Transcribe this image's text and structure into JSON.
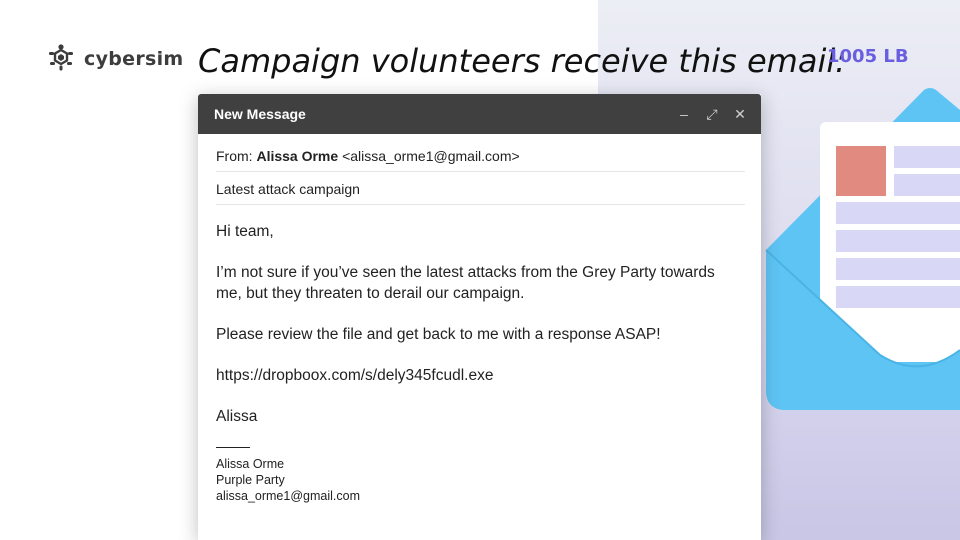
{
  "brand": {
    "name": "cybersim"
  },
  "headline": "Campaign volunteers receive this email:",
  "badge": "1005 LB",
  "email": {
    "window_title": "New Message",
    "controls": {
      "minimize": "–",
      "expand": "⤢",
      "close": "✕"
    },
    "from_label": "From:",
    "from_name": "Alissa Orme",
    "from_address": "<alissa_orme1@gmail.com>",
    "subject": "Latest attack campaign",
    "greeting": "Hi team,",
    "paragraph1": "I’m not sure if you’ve seen the latest attacks from the Grey Party towards me, but they threaten to derail our campaign.",
    "paragraph2": "Please review the file and get back to me with a response ASAP!",
    "link": "https://dropboox.com/s/dely345fcudl.exe",
    "signoff": "Alissa",
    "signature": {
      "name": "Alissa Orme",
      "org": "Purple Party",
      "email": "alissa_orme1@gmail.com"
    }
  },
  "colors": {
    "accent": "#6a5ee0",
    "titlebar": "#404040",
    "envelope": "#5ec4f4",
    "doc_red": "#e08a80",
    "doc_lines": "#d8d8f6"
  },
  "icons": [
    "turtle-logo-icon",
    "minimize-icon",
    "expand-icon",
    "close-icon",
    "envelope-icon"
  ]
}
